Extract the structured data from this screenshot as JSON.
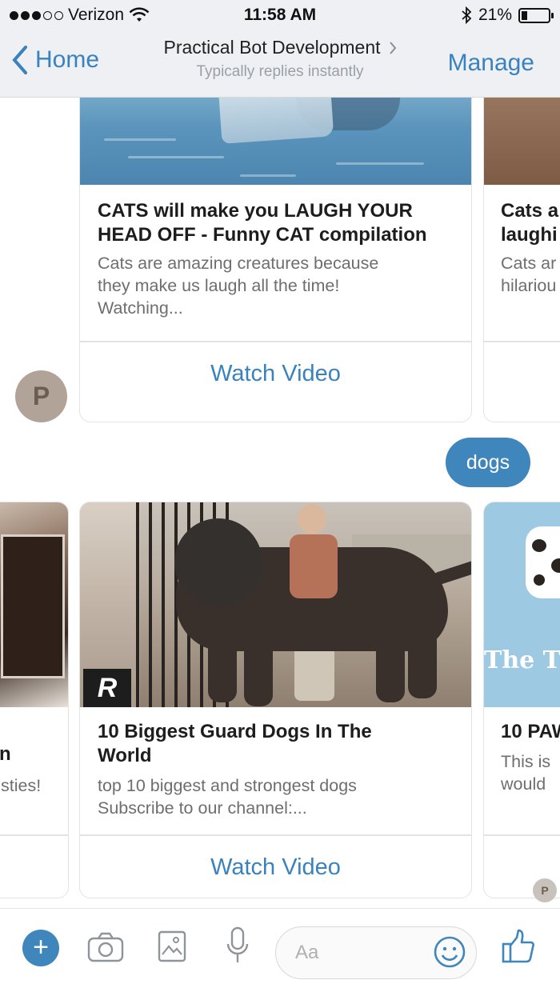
{
  "status_bar": {
    "carrier": "Verizon",
    "time": "11:58 AM",
    "battery": "21%",
    "battery_level": 0.21,
    "signal_bars_filled": 3,
    "signal_bars_total": 5
  },
  "nav": {
    "back_label": "Home",
    "title": "Practical Bot Development",
    "subtitle": "Typically replies instantly",
    "manage_label": "Manage"
  },
  "cat_cards": [
    {
      "title_line1": "CATS will make you LAUGH YOUR",
      "title_line2": "HEAD OFF - Funny CAT compilation",
      "desc_line1": "Cats are amazing creatures because",
      "desc_line2": "they make us laugh all the time!",
      "desc_line3": "Watching...",
      "action": "Watch Video"
    },
    {
      "title_line1": "Cats a",
      "title_line2": "laughi",
      "desc_line1": "Cats ar",
      "desc_line2": "hilariou"
    }
  ],
  "bot_avatar_letter": "P",
  "user_message": "dogs",
  "dog_cards": [
    {
      "title_line1": "n",
      "desc_line1": "sties!"
    },
    {
      "title_line1": "10 Biggest Guard Dogs In The",
      "title_line2": "World",
      "desc_line1": "top 10 biggest and strongest dogs",
      "desc_line2": "Subscribe to our channel:...",
      "action": "Watch Video",
      "badge": "R"
    },
    {
      "title_line1": "10 PAW",
      "desc_line1": "This is",
      "desc_line2": "would",
      "image_text": "The T"
    }
  ],
  "composer": {
    "placeholder": "Aa",
    "plus_label": "+"
  },
  "colors": {
    "accent": "#3a82be",
    "bubble": "#3f86bc",
    "nav_bg": "#eef0f3"
  },
  "icons": [
    "wifi-icon",
    "bluetooth-icon",
    "battery-icon",
    "chevron-left-icon",
    "chevron-right-icon",
    "plus-icon",
    "camera-icon",
    "image-icon",
    "microphone-icon",
    "smile-icon",
    "thumbs-up-icon"
  ]
}
